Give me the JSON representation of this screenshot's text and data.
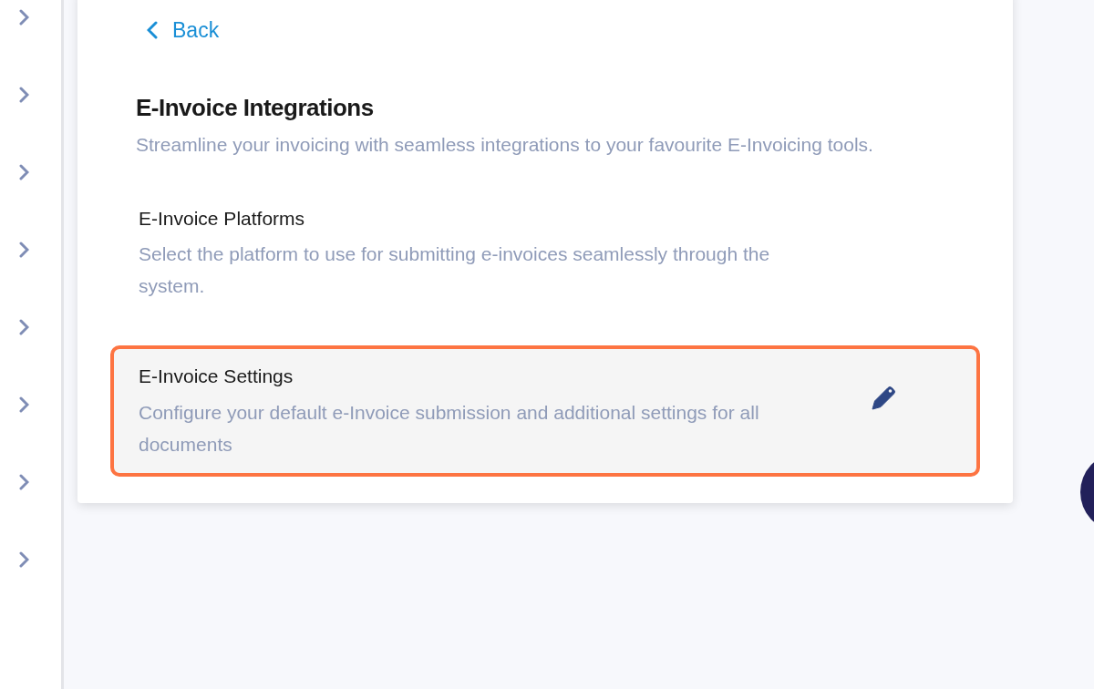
{
  "back": {
    "label": "Back"
  },
  "page": {
    "title": "E-Invoice Integrations",
    "subtitle": "Streamline your invoicing with seamless integrations to your favourite E-Invoicing tools."
  },
  "sections": [
    {
      "title": "E-Invoice Platforms",
      "description": "Select the platform to use for submitting e-invoices seamlessly through the system.",
      "editable": false,
      "highlighted": false
    },
    {
      "title": "E-Invoice Settings",
      "description": "Configure your default e-Invoice submission and additional settings for all documents",
      "editable": true,
      "highlighted": true
    }
  ]
}
